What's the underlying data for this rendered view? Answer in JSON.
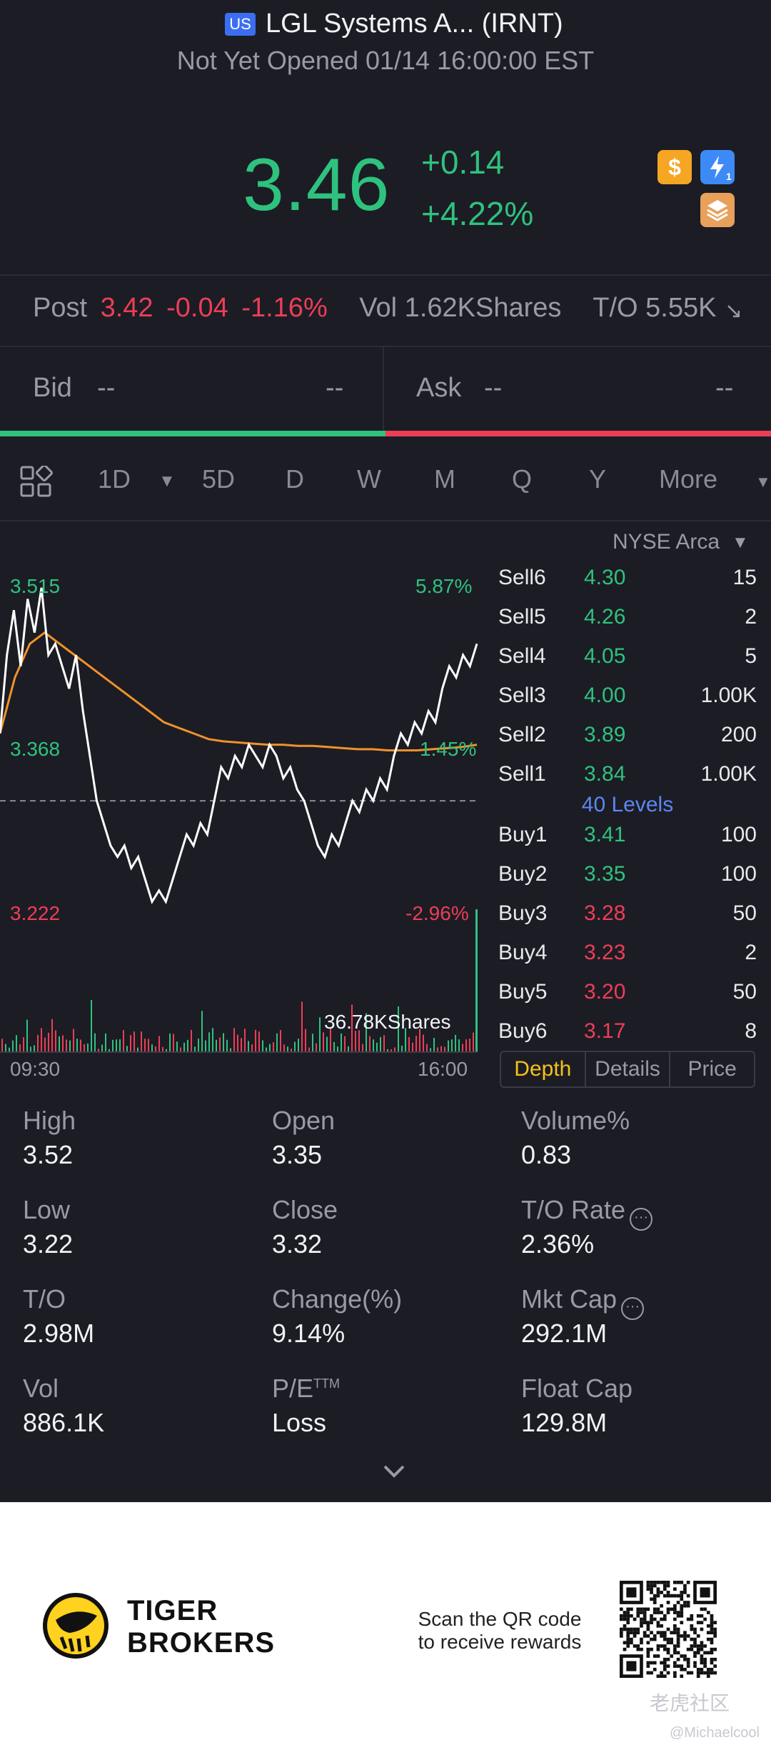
{
  "header": {
    "market_badge": "US",
    "title": "LGL Systems A... (IRNT)",
    "status": "Not Yet Opened 01/14 16:00:00 EST"
  },
  "quote": {
    "price": "3.46",
    "change": "+0.14",
    "change_pct": "+4.22%",
    "icons": [
      "dollar-icon",
      "flash-icon",
      "layers-icon"
    ]
  },
  "post": {
    "label": "Post",
    "price": "3.42",
    "change": "-0.04",
    "change_pct": "-1.16%",
    "vol": "Vol 1.62KShares",
    "turnover": "T/O 5.55K"
  },
  "bidask": {
    "bid_label": "Bid",
    "bid_price": "--",
    "bid_size": "--",
    "ask_label": "Ask",
    "ask_price": "--",
    "ask_size": "--"
  },
  "tabs": {
    "items": [
      "1D",
      "5D",
      "D",
      "W",
      "M",
      "Q",
      "Y",
      "More"
    ],
    "active": "1D"
  },
  "chart": {
    "high_price": "3.515",
    "high_pct": "5.87%",
    "mid_price": "3.368",
    "mid_pct": "1.45%",
    "low_price": "3.222",
    "low_pct": "-2.96%",
    "volume_label": "36.78KShares",
    "time_start": "09:30",
    "time_end": "16:00"
  },
  "chart_data": {
    "type": "line",
    "series": [
      {
        "values": [
          3.38,
          3.45,
          3.49,
          3.44,
          3.5,
          3.47,
          3.51,
          3.45,
          3.46,
          3.44,
          3.42,
          3.45,
          3.4,
          3.36,
          3.32,
          3.3,
          3.28,
          3.27,
          3.28,
          3.26,
          3.27,
          3.25,
          3.23,
          3.24,
          3.23,
          3.25,
          3.27,
          3.29,
          3.28,
          3.3,
          3.29,
          3.32,
          3.35,
          3.34,
          3.36,
          3.35,
          3.37,
          3.36,
          3.35,
          3.37,
          3.36,
          3.34,
          3.35,
          3.33,
          3.32,
          3.3,
          3.28,
          3.27,
          3.29,
          3.28,
          3.3,
          3.32,
          3.31,
          3.33,
          3.32,
          3.34,
          3.33,
          3.36,
          3.38,
          3.37,
          3.39,
          3.38,
          3.4,
          3.39,
          3.42,
          3.44,
          3.43,
          3.45,
          3.44,
          3.46
        ]
      },
      {
        "values": [
          3.38,
          3.43,
          3.46,
          3.47,
          3.46,
          3.45,
          3.44,
          3.43,
          3.42,
          3.41,
          3.4,
          3.39,
          3.385,
          3.38,
          3.375,
          3.373,
          3.372,
          3.371,
          3.37,
          3.37,
          3.369,
          3.369,
          3.368,
          3.367,
          3.366,
          3.366,
          3.365,
          3.365,
          3.365,
          3.366,
          3.367,
          3.368,
          3.37
        ]
      }
    ],
    "ylim": [
      3.222,
      3.515
    ],
    "x_range": [
      "09:30",
      "16:00"
    ],
    "reference_price": 3.32
  },
  "depth": {
    "exchange": "NYSE Arca",
    "sell": [
      {
        "name": "Sell6",
        "price": "4.30",
        "qty": "15"
      },
      {
        "name": "Sell5",
        "price": "4.26",
        "qty": "2"
      },
      {
        "name": "Sell4",
        "price": "4.05",
        "qty": "5"
      },
      {
        "name": "Sell3",
        "price": "4.00",
        "qty": "1.00K"
      },
      {
        "name": "Sell2",
        "price": "3.89",
        "qty": "200"
      },
      {
        "name": "Sell1",
        "price": "3.84",
        "qty": "1.00K"
      }
    ],
    "levels": "40 Levels",
    "buy": [
      {
        "name": "Buy1",
        "price": "3.41",
        "qty": "100"
      },
      {
        "name": "Buy2",
        "price": "3.35",
        "qty": "100"
      },
      {
        "name": "Buy3",
        "price": "3.28",
        "qty": "50"
      },
      {
        "name": "Buy4",
        "price": "3.23",
        "qty": "2"
      },
      {
        "name": "Buy5",
        "price": "3.20",
        "qty": "50"
      },
      {
        "name": "Buy6",
        "price": "3.17",
        "qty": "8"
      }
    ],
    "tabs": [
      "Depth",
      "Details",
      "Price"
    ]
  },
  "stats": [
    {
      "label": "High",
      "value": "3.52"
    },
    {
      "label": "Open",
      "value": "3.35"
    },
    {
      "label": "Volume%",
      "value": "0.83"
    },
    {
      "label": "Low",
      "value": "3.22"
    },
    {
      "label": "Close",
      "value": "3.32"
    },
    {
      "label": "T/O Rate",
      "value": "2.36%"
    },
    {
      "label": "T/O",
      "value": "2.98M"
    },
    {
      "label": "Change(%)",
      "value": "9.14%"
    },
    {
      "label": "Mkt Cap",
      "value": "292.1M"
    },
    {
      "label": "Vol",
      "value": "886.1K"
    },
    {
      "label": "P/E",
      "label_sup": "TTM",
      "value": "Loss"
    },
    {
      "label": "Float Cap",
      "value": "129.8M"
    }
  ],
  "footer": {
    "brand_line1": "TIGER",
    "brand_line2": "BROKERS",
    "scan_line1": "Scan the QR code",
    "scan_line2": "to receive rewards",
    "watermark": "老虎社区",
    "watermark_user": "@Michaelcool"
  },
  "colors": {
    "up": "#2ec27e",
    "down": "#ec3e56",
    "accent": "#f5c21b",
    "avg_line": "#f0922a",
    "background": "#1c1c24"
  }
}
